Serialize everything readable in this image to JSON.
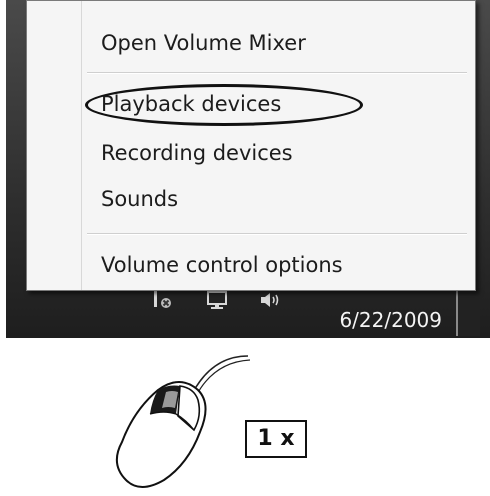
{
  "context_menu": {
    "items": [
      {
        "label": "Open Volume Mixer"
      },
      {
        "label": "Playback devices"
      },
      {
        "label": "Recording devices"
      },
      {
        "label": "Sounds"
      },
      {
        "label": "Volume control options"
      }
    ]
  },
  "taskbar": {
    "clock_date": "6/22/2009",
    "tray_icons": [
      "network-error-icon",
      "display-icon",
      "speaker-icon"
    ]
  },
  "instruction": {
    "click_count": "1 x",
    "mouse_button_pressed": "left"
  },
  "colors": {
    "menu_background": "#f5f5f5",
    "taskbar": "#2e2e2e",
    "highlight": "#111111"
  }
}
